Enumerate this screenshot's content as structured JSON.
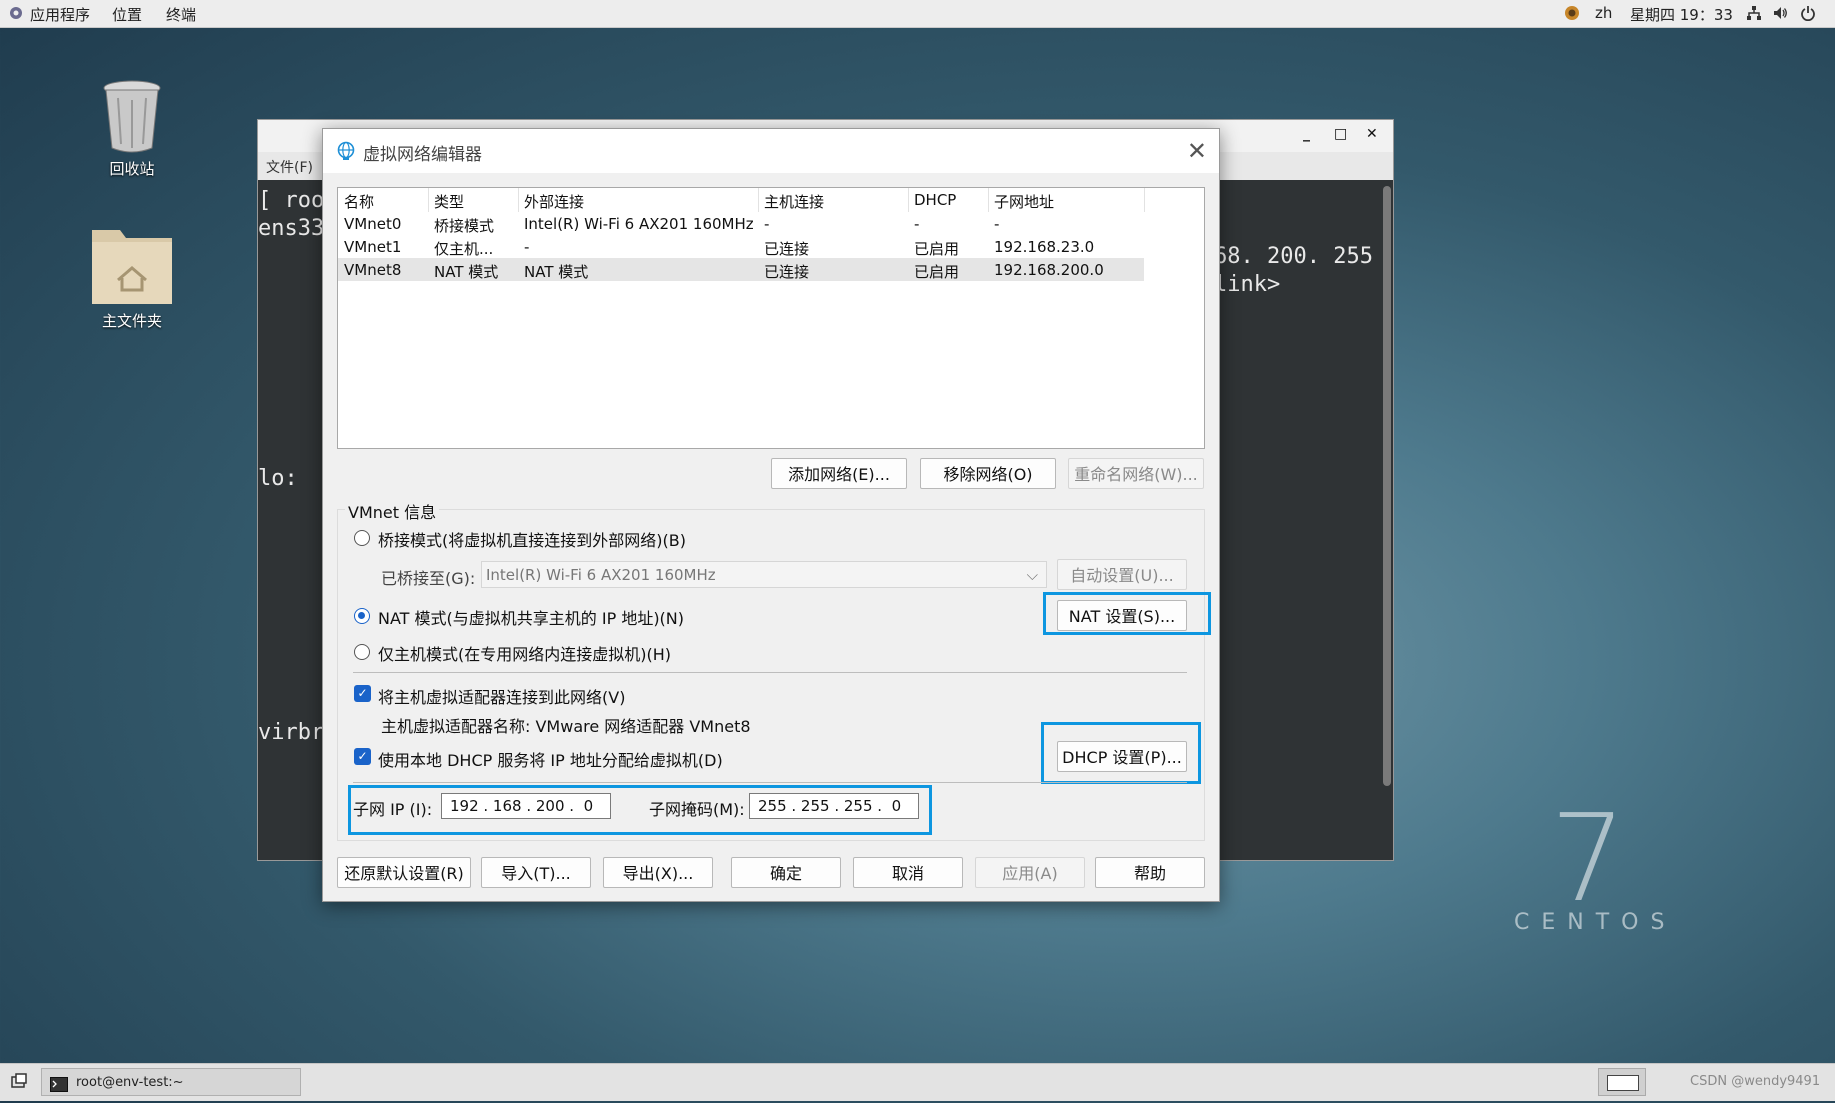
{
  "topbar": {
    "menu": [
      "应用程序",
      "位置",
      "终端"
    ],
    "lang": "zh",
    "clock": "星期四 19：33"
  },
  "desktop": {
    "trash_label": "回收站",
    "home_label": "主文件夹"
  },
  "terminal": {
    "menu_file": "文件(F)",
    "lines": [
      "[ root",
      "ens33",
      "lo:  f",
      "virbr"
    ],
    "right_lines": [
      "68. 200. 255",
      "link>"
    ]
  },
  "dialog": {
    "title": "虚拟网络编辑器",
    "table": {
      "headers": [
        "名称",
        "类型",
        "外部连接",
        "主机连接",
        "DHCP",
        "子网地址"
      ],
      "rows": [
        [
          "VMnet0",
          "桥接模式",
          "Intel(R) Wi-Fi 6 AX201 160MHz",
          "-",
          "-",
          "-"
        ],
        [
          "VMnet1",
          "仅主机...",
          "-",
          "已连接",
          "已启用",
          "192.168.23.0"
        ],
        [
          "VMnet8",
          "NAT 模式",
          "NAT 模式",
          "已连接",
          "已启用",
          "192.168.200.0"
        ]
      ]
    },
    "buttons": {
      "add_network": "添加网络(E)...",
      "remove_network": "移除网络(O)",
      "rename_network": "重命名网络(W)..."
    },
    "vmnet_info": {
      "group_label": "VMnet 信息",
      "bridge_mode": "桥接模式(将虚拟机直接连接到外部网络)(B)",
      "bridged_to_label": "已桥接至(G):",
      "bridged_to_value": "Intel(R) Wi-Fi 6 AX201 160MHz",
      "auto_settings": "自动设置(U)...",
      "nat_mode": "NAT 模式(与虚拟机共享主机的 IP 地址)(N)",
      "nat_settings": "NAT 设置(S)...",
      "host_only": "仅主机模式(在专用网络内连接虚拟机)(H)",
      "connect_adapter": "将主机虚拟适配器连接到此网络(V)",
      "adapter_name": "主机虚拟适配器名称: VMware 网络适配器 VMnet8",
      "use_dhcp": "使用本地 DHCP 服务将 IP 地址分配给虚拟机(D)",
      "dhcp_settings": "DHCP 设置(P)...",
      "subnet_ip_label": "子网 IP (I):",
      "subnet_ip": "192 . 168 . 200 .  0",
      "subnet_mask_label": "子网掩码(M):",
      "subnet_mask": "255 . 255 . 255 .  0",
      "selected_mode": "nat"
    },
    "footer": {
      "restore": "还原默认设置(R)",
      "import": "导入(T)...",
      "export": "导出(X)...",
      "ok": "确定",
      "cancel": "取消",
      "apply": "应用(A)",
      "help": "帮助"
    }
  },
  "taskbar": {
    "task_label": "root@env-test:~",
    "watermark": "CSDN @wendy9491"
  },
  "branding": {
    "number": "7",
    "word": "CENTOS"
  },
  "colors": {
    "highlight": "#0d96e0",
    "accent": "#1a63c9"
  }
}
